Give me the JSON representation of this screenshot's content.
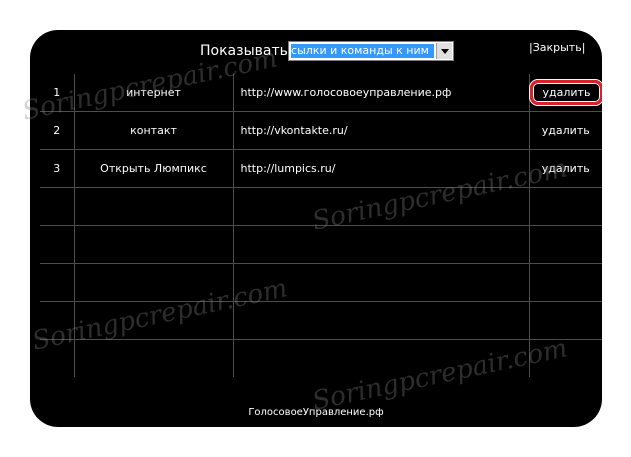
{
  "header": {
    "show_label": "Показывать",
    "filter_selected": "ссылки и команды к ним",
    "close_label": "|Закрыть|"
  },
  "rows": [
    {
      "num": "1",
      "name": "интернет",
      "url": "http://www.голосовоеуправление.рф",
      "action": "удалить"
    },
    {
      "num": "2",
      "name": "контакт",
      "url": "http://vkontakte.ru/",
      "action": "удалить"
    },
    {
      "num": "3",
      "name": "Открыть Люмпикс",
      "url": "http://lumpics.ru/",
      "action": "удалить"
    },
    {
      "num": "",
      "name": "",
      "url": "",
      "action": ""
    },
    {
      "num": "",
      "name": "",
      "url": "",
      "action": ""
    },
    {
      "num": "",
      "name": "",
      "url": "",
      "action": ""
    },
    {
      "num": "",
      "name": "",
      "url": "",
      "action": ""
    },
    {
      "num": "",
      "name": "",
      "url": "",
      "action": ""
    }
  ],
  "footer": {
    "site": "ГолосовоеУправление.рф"
  },
  "watermark": "Soringpcrepair.com",
  "colors": {
    "panel_bg": "#000000",
    "selection": "#3399ff",
    "highlight": "#d6232a",
    "grid": "#4d4d4d"
  },
  "icons": {
    "dropdown": "chevron-down-icon"
  }
}
